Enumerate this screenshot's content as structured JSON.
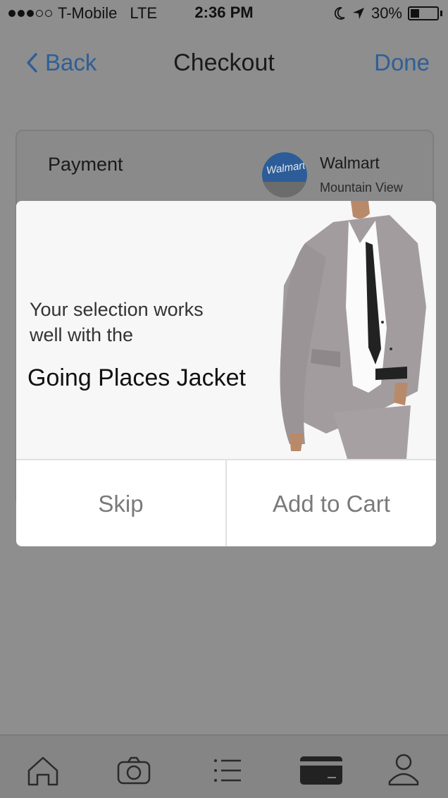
{
  "status_bar": {
    "carrier": "T-Mobile",
    "network": "LTE",
    "time": "2:36 PM",
    "battery_percent": "30%",
    "signal_bars": 3
  },
  "nav": {
    "back_label": "Back",
    "title": "Checkout",
    "done_label": "Done"
  },
  "payment": {
    "label": "Payment",
    "store_logo_text": "Walmart",
    "store_name": "Walmart",
    "store_location": "Mountain View"
  },
  "modal": {
    "intro": "Your selection works well with the",
    "product_name": "Going Places Jacket",
    "skip_label": "Skip",
    "add_to_cart_label": "Add to Cart"
  },
  "tab_bar": {
    "tabs": [
      "home-icon",
      "camera-icon",
      "list-icon",
      "card-icon",
      "profile-icon"
    ],
    "active_tab": "card-icon"
  },
  "colors": {
    "accent": "#2e5f96",
    "overlay": "#8e8e8e",
    "modal_bg": "#ffffff"
  }
}
